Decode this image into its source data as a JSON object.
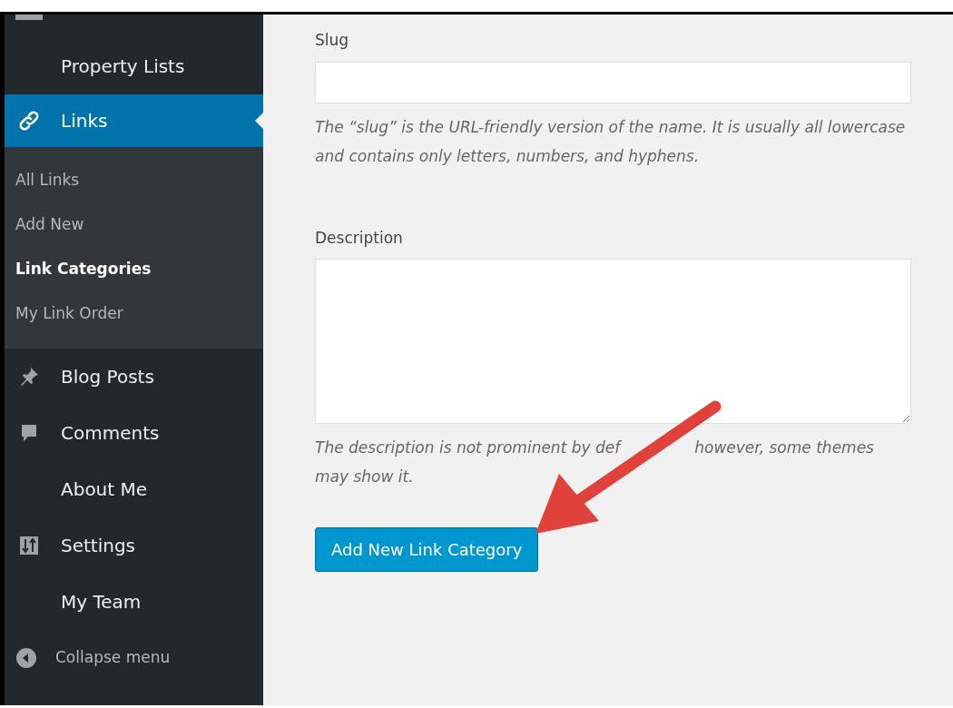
{
  "sidebar": {
    "items": [
      {
        "label": "Property Lists",
        "selected": false
      },
      {
        "label": "Links",
        "selected": true,
        "children": [
          {
            "label": "All Links",
            "selected": false
          },
          {
            "label": "Add New",
            "selected": false
          },
          {
            "label": "Link Categories",
            "selected": true
          },
          {
            "label": "My Link Order",
            "selected": false
          }
        ]
      },
      {
        "label": "Blog Posts",
        "selected": false
      },
      {
        "label": "Comments",
        "selected": false
      },
      {
        "label": "About Me",
        "selected": false
      },
      {
        "label": "Settings",
        "selected": false
      },
      {
        "label": "My Team",
        "selected": false
      }
    ],
    "collapse": "Collapse menu"
  },
  "form": {
    "fields": [
      {
        "kind": "input",
        "label": "Slug",
        "help": [
          "The “slug” is the URL-friendly version of the name. It is usually all lowercase and contains only letters, numbers, and hyphens."
        ]
      },
      {
        "kind": "textarea",
        "label": "Description",
        "help": [
          "The description is not prominent by def",
          "however, some themes",
          "may show it."
        ]
      }
    ],
    "submit": "Add New Link Category"
  }
}
